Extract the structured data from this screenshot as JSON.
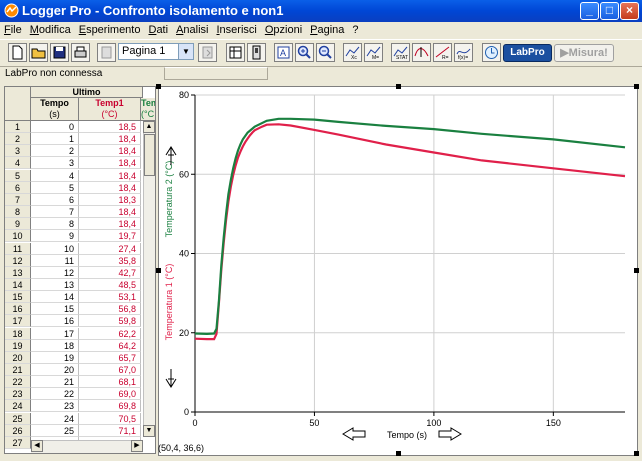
{
  "window": {
    "title": "Logger Pro - Confronto isolamento e non1"
  },
  "menu": [
    "File",
    "Modifica",
    "Esperimento",
    "Dati",
    "Analisi",
    "Inserisci",
    "Opzioni",
    "Pagina",
    "?"
  ],
  "toolbar": {
    "page_select": "Pagina 1",
    "labpro_label": "LabPro",
    "misura_label": "Misura!"
  },
  "status": {
    "text": "LabPro non connessa"
  },
  "table": {
    "group_header": "Ultimo",
    "columns": [
      {
        "name": "Tempo",
        "unit": "(s)"
      },
      {
        "name": "Temp1",
        "unit": "(°C)"
      },
      {
        "name": "Tem",
        "unit": "(°C"
      }
    ],
    "rows": [
      [
        "1",
        "0",
        "18,5"
      ],
      [
        "2",
        "1",
        "18,4"
      ],
      [
        "3",
        "2",
        "18,4"
      ],
      [
        "4",
        "3",
        "18,4"
      ],
      [
        "5",
        "4",
        "18,4"
      ],
      [
        "6",
        "5",
        "18,4"
      ],
      [
        "7",
        "6",
        "18,3"
      ],
      [
        "8",
        "7",
        "18,4"
      ],
      [
        "9",
        "8",
        "18,4"
      ],
      [
        "10",
        "9",
        "19,7"
      ],
      [
        "11",
        "10",
        "27,4"
      ],
      [
        "12",
        "11",
        "35,8"
      ],
      [
        "13",
        "12",
        "42,7"
      ],
      [
        "14",
        "13",
        "48,5"
      ],
      [
        "15",
        "14",
        "53,1"
      ],
      [
        "16",
        "15",
        "56,8"
      ],
      [
        "17",
        "16",
        "59,8"
      ],
      [
        "18",
        "17",
        "62,2"
      ],
      [
        "19",
        "18",
        "64,2"
      ],
      [
        "20",
        "19",
        "65,7"
      ],
      [
        "21",
        "20",
        "67,0"
      ],
      [
        "22",
        "21",
        "68,1"
      ],
      [
        "23",
        "22",
        "69,0"
      ],
      [
        "24",
        "23",
        "69,8"
      ],
      [
        "25",
        "24",
        "70,5"
      ],
      [
        "26",
        "25",
        "71,1"
      ],
      [
        "27",
        "",
        ""
      ]
    ]
  },
  "graph": {
    "coord_readout": "(50,4, 36,6)",
    "xlabel": "Tempo (s)",
    "ylabel1": "Temperatura 1 (°C)",
    "ylabel2": "Temperatura 2 (°C)"
  },
  "chart_data": {
    "type": "line",
    "xlabel": "Tempo (s)",
    "ylabel": "Temperatura 1 (°C) / Temperatura 2 (°C)",
    "xlim": [
      0,
      180
    ],
    "ylim": [
      0,
      80
    ],
    "xticks": [
      "0",
      "50",
      "100",
      "150"
    ],
    "yticks": [
      "0",
      "20",
      "40",
      "60",
      "80"
    ],
    "grid": true,
    "series": [
      {
        "name": "Temperatura 1 (°C)",
        "color": "#e0204a",
        "x": [
          0,
          5,
          8,
          9,
          10,
          11,
          12,
          13,
          14,
          15,
          16,
          17,
          18,
          19,
          20,
          21,
          22,
          23,
          24,
          25,
          28,
          30,
          35,
          40,
          50,
          60,
          80,
          100,
          120,
          150,
          180
        ],
        "y": [
          18.5,
          18.4,
          18.4,
          19.7,
          27.4,
          35.8,
          42.7,
          48.5,
          53.1,
          56.8,
          59.8,
          62.2,
          64.2,
          65.7,
          67.0,
          68.1,
          69.0,
          69.8,
          70.5,
          71.1,
          72.0,
          72.5,
          72.6,
          72.3,
          71.2,
          70.0,
          67.5,
          65.5,
          63.5,
          61.5,
          59.5
        ]
      },
      {
        "name": "Temperatura 2 (°C)",
        "color": "#1a8040",
        "x": [
          0,
          5,
          8,
          9,
          10,
          11,
          12,
          13,
          14,
          15,
          16,
          17,
          18,
          19,
          20,
          22,
          25,
          30,
          35,
          40,
          50,
          60,
          80,
          100,
          120,
          150,
          180
        ],
        "y": [
          19.8,
          19.7,
          19.8,
          21.0,
          28.0,
          37.0,
          44.0,
          50.0,
          55.0,
          58.5,
          61.5,
          64.0,
          66.0,
          67.5,
          68.8,
          70.5,
          72.0,
          73.5,
          74.0,
          74.0,
          73.8,
          73.2,
          72.2,
          71.4,
          70.2,
          68.8,
          66.8
        ]
      }
    ]
  },
  "colors": {
    "titlebar": "#0a5fe8",
    "temp1": "#e0204a",
    "temp2": "#1a8040"
  }
}
